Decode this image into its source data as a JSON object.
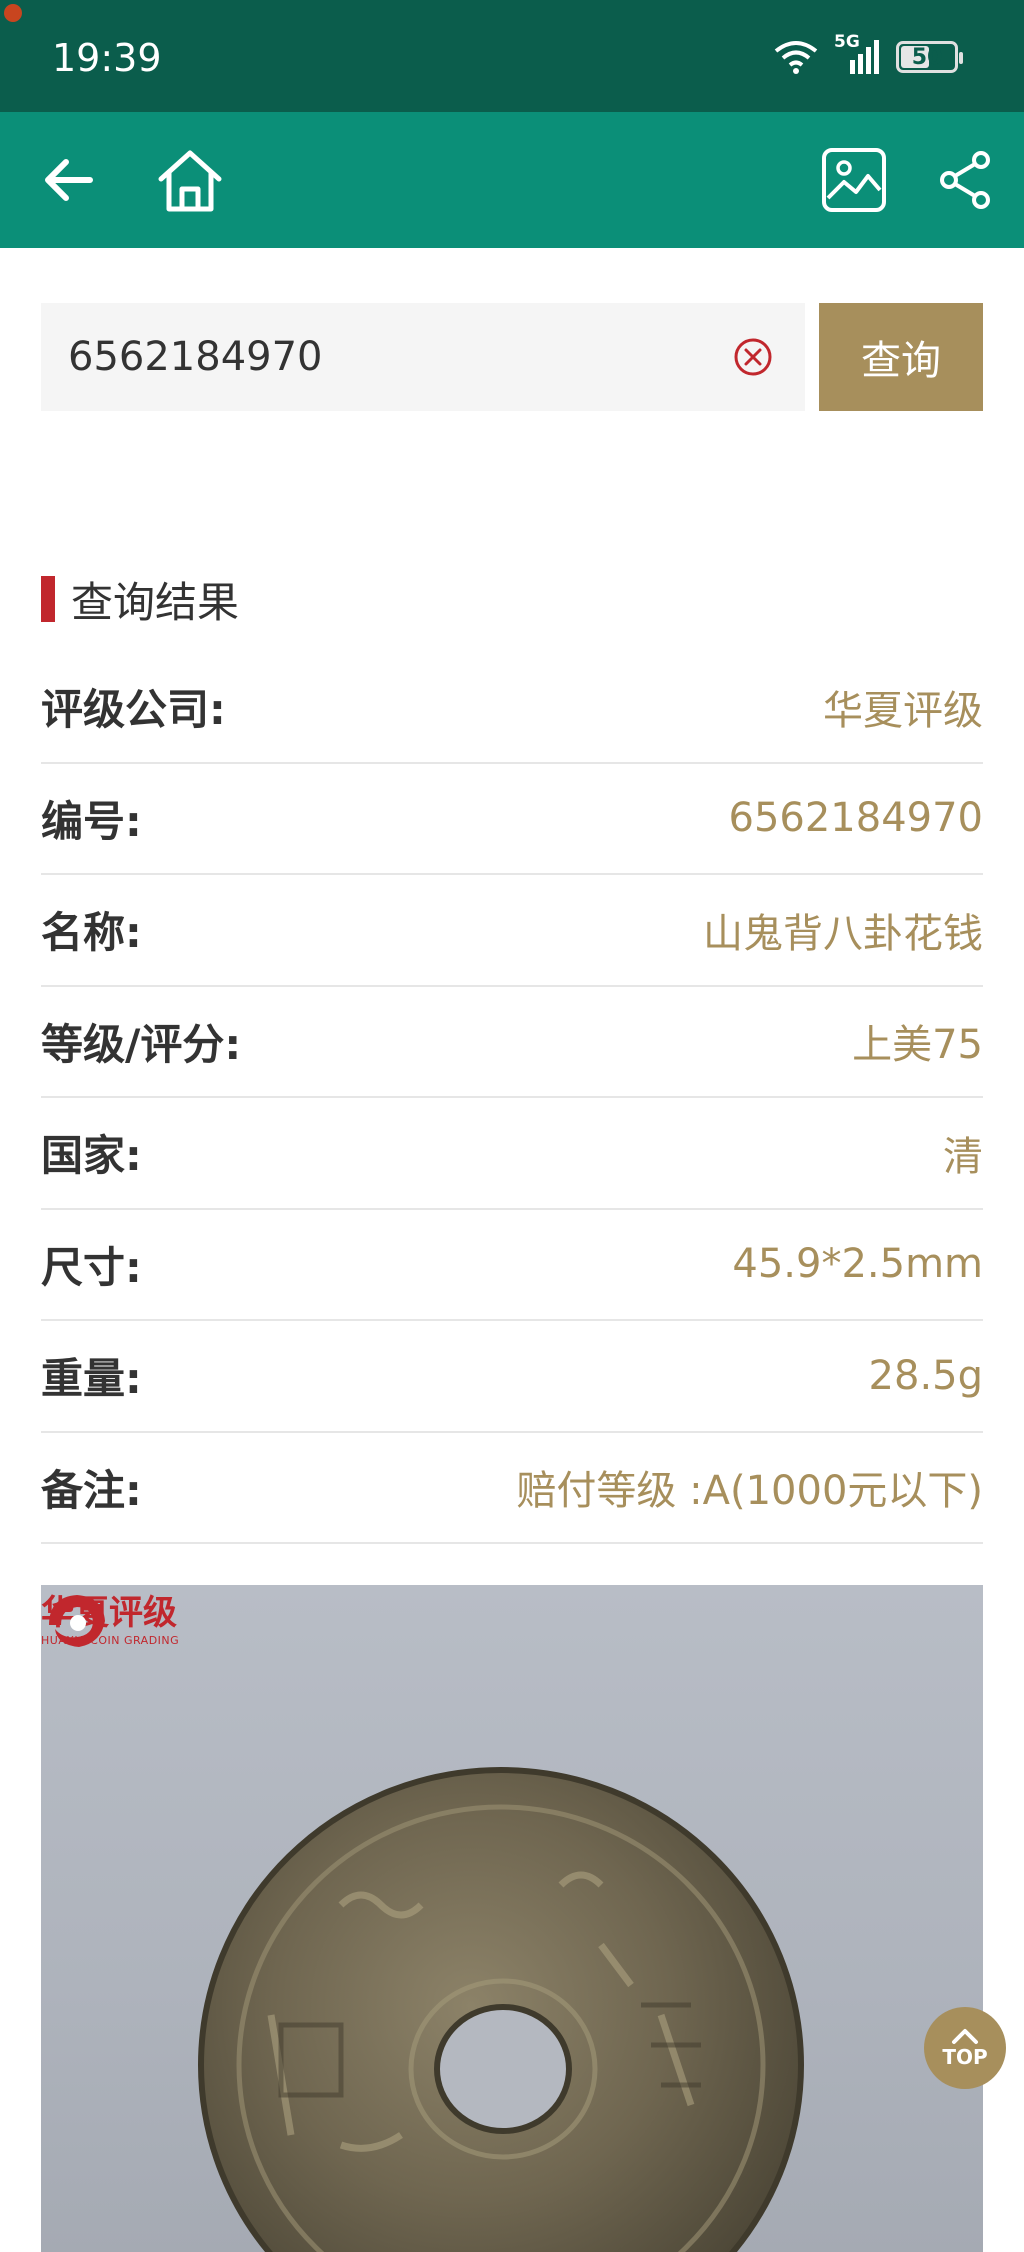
{
  "status_bar": {
    "time": "19:39",
    "network": "5G",
    "battery": "50",
    "battery_level": 0.5
  },
  "app_bar": {
    "back_icon": "arrow-left-icon",
    "home_icon": "home-icon",
    "gallery_icon": "image-icon",
    "share_icon": "share-icon"
  },
  "search": {
    "value": "6562184970",
    "clear_icon": "clear-circle-icon",
    "button_label": "查询"
  },
  "results": {
    "title": "查询结果",
    "rows": [
      {
        "label": "评级公司:",
        "value": "华夏评级"
      },
      {
        "label": "编号:",
        "value": "6562184970"
      },
      {
        "label": "名称:",
        "value": "山鬼背八卦花钱"
      },
      {
        "label": "等级/评分:",
        "value": "上美75"
      },
      {
        "label": "国家:",
        "value": "清"
      },
      {
        "label": "尺寸:",
        "value": "45.9*2.5mm"
      },
      {
        "label": "重量:",
        "value": "28.5g"
      },
      {
        "label": "备注:",
        "value": "赔付等级 :A(1000元以下)"
      }
    ]
  },
  "photo": {
    "brand_cn": "华夏评级",
    "brand_en": "HUAXIA COIN GRADING"
  },
  "top_button": {
    "label": "TOP"
  },
  "colors": {
    "status_bar": "#0b5d4c",
    "app_bar": "#0b8f78",
    "accent_gold": "#a78f5c",
    "accent_red": "#c1272d"
  }
}
